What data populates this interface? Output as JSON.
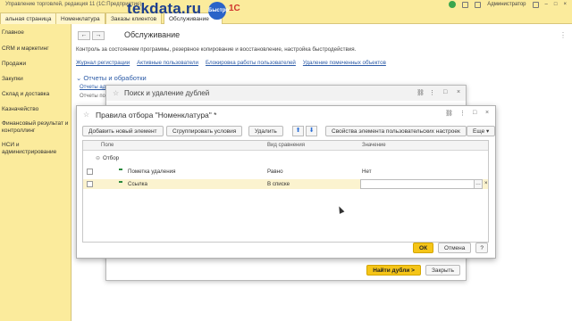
{
  "window": {
    "title": "Управление торговлей, редакция 11  (1С:Предприятие)",
    "user": "Администратор"
  },
  "watermark": {
    "text": "tekdata.ru",
    "badge": "Быстро Легко",
    "brand": "1С"
  },
  "tabs": [
    {
      "label": "альная страница"
    },
    {
      "label": "Номенклатура"
    },
    {
      "label": "Заказы клиентов"
    },
    {
      "label": "Обслуживание",
      "close": "×"
    }
  ],
  "sidebar": {
    "items": [
      {
        "label": "Главное"
      },
      {
        "label": "CRM и маркетинг"
      },
      {
        "label": "Продажи"
      },
      {
        "label": "Закупки"
      },
      {
        "label": "Склад и доставка"
      },
      {
        "label": "Казначейство"
      },
      {
        "label": "Финансовый результат и контроллинг"
      },
      {
        "label": "НСИ и администрирование"
      }
    ]
  },
  "main": {
    "back": "←",
    "forward": "→",
    "title": "Обслуживание",
    "description": "Контроль за состоянием программы, резервное копирование и восстановление, настройка быстродействия.",
    "links": [
      "Журнал регистрации",
      "Активные пользователи",
      "Блокировка работы пользователей",
      "Удаление помеченных объектов"
    ],
    "section": "Отчеты и обработки",
    "sub_link": "Отчеты ад",
    "sub_text": "Отчеты по"
  },
  "dialog_search": {
    "title": "Поиск и удаление дублей",
    "find_button": "Найти дубли >",
    "close_button": "Закрыть"
  },
  "dialog_filter": {
    "title": "Правила отбора \"Номенклатура\" *",
    "toolbar": {
      "add": "Добавить новый элемент",
      "group": "Сгруппировать условия",
      "delete": "Удалить",
      "up": "⬆",
      "down": "⬇",
      "settings": "Свойства элемента пользовательских настроек",
      "more": "Еще"
    },
    "columns": {
      "field": "Поле",
      "comparison": "Вид сравнения",
      "value": "Значение"
    },
    "rows": [
      {
        "field": "Отбор",
        "comparison": "",
        "value": ""
      },
      {
        "field": "Пометка удаления",
        "comparison": "Равно",
        "value": "Нет"
      },
      {
        "field": "Ссылка",
        "comparison": "В списке",
        "value": ""
      }
    ],
    "ok": "ОК",
    "cancel": "Отмена"
  },
  "colors": {
    "accent": "#fbeb9c",
    "link": "#2b5aa6",
    "primary_button": "#f5c518"
  }
}
